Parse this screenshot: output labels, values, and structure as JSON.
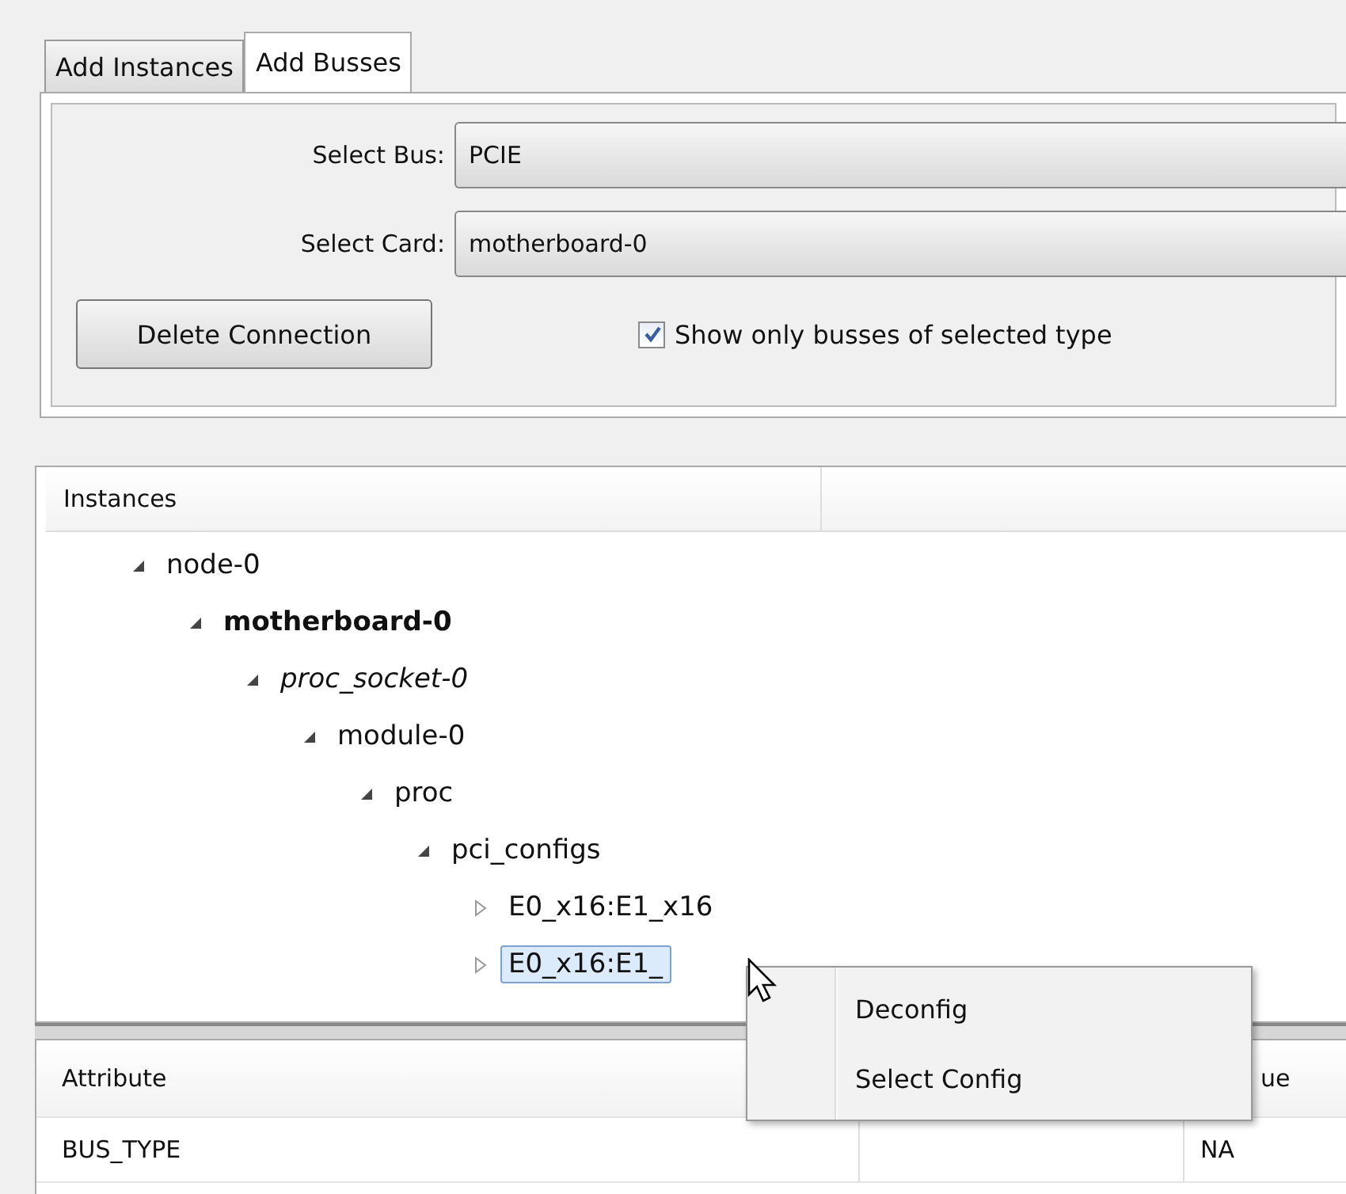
{
  "tabs": [
    {
      "label": "Add Instances",
      "selected": false
    },
    {
      "label": "Add Busses",
      "selected": true
    }
  ],
  "form": {
    "fields": [
      {
        "label": "Select Bus:",
        "value": "PCIE"
      },
      {
        "label": "Select Card:",
        "value": "motherboard-0"
      }
    ],
    "delete_button": "Delete Connection",
    "filter_checkbox": {
      "label": "Show only busses of selected type",
      "checked": true
    }
  },
  "tree": {
    "column": "Instances",
    "nodes": [
      {
        "label": "node-0",
        "expanded": true,
        "selected": false,
        "kind": "plain",
        "children": [
          {
            "label": "motherboard-0",
            "expanded": true,
            "selected": false,
            "kind": "bold",
            "children": [
              {
                "label": "proc_socket-0",
                "expanded": true,
                "selected": false,
                "kind": "italic",
                "children": [
                  {
                    "label": "module-0",
                    "expanded": true,
                    "selected": false,
                    "kind": "plain",
                    "children": [
                      {
                        "label": "proc",
                        "expanded": true,
                        "selected": false,
                        "kind": "plain",
                        "children": [
                          {
                            "label": "pci_configs",
                            "expanded": true,
                            "selected": false,
                            "kind": "plain",
                            "children": [
                              {
                                "label": "E0_x16:E1_x16",
                                "expanded": false,
                                "selected": false,
                                "kind": "plain"
                              },
                              {
                                "label": "E0_x16:E1_",
                                "expanded": false,
                                "selected": true,
                                "kind": "plain"
                              }
                            ]
                          }
                        ]
                      }
                    ]
                  }
                ]
              }
            ]
          }
        ]
      }
    ]
  },
  "context_menu": {
    "items": [
      "Deconfig",
      "Select Config"
    ]
  },
  "attributes": {
    "columns": [
      "Attribute",
      "",
      "ue"
    ],
    "rows": [
      [
        "BUS_TYPE",
        "",
        "NA"
      ]
    ]
  }
}
